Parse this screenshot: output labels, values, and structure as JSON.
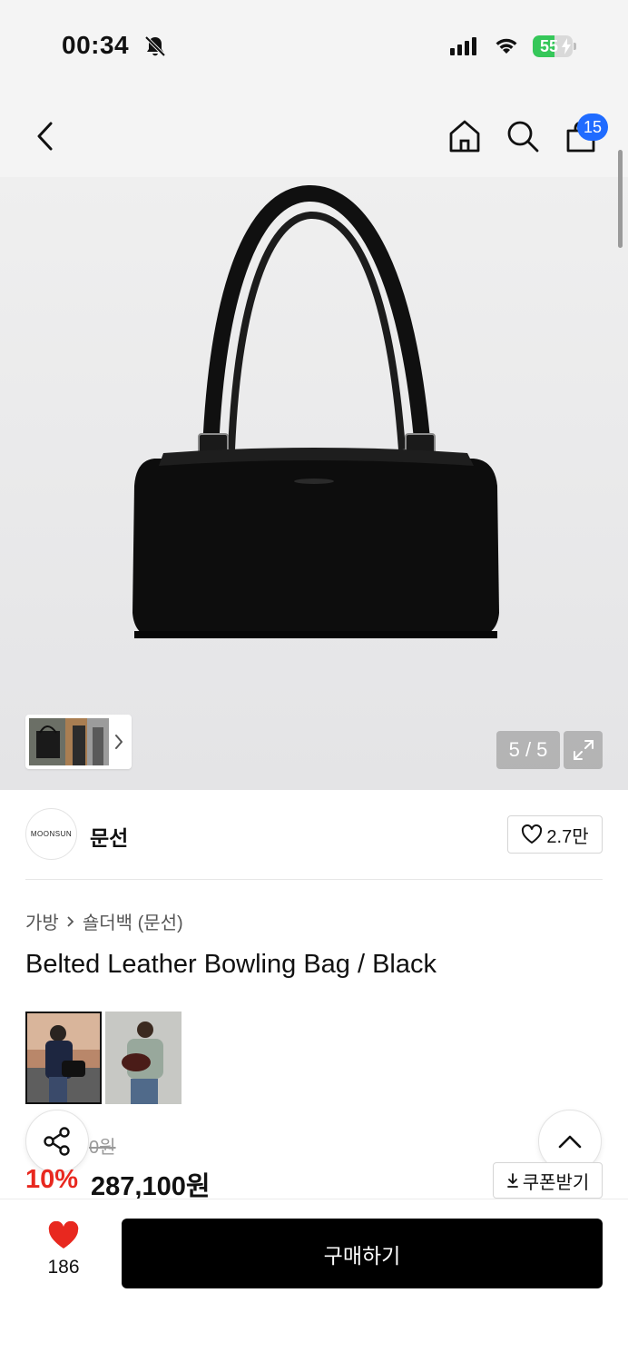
{
  "status_bar": {
    "time": "00:34",
    "battery": "55",
    "battery_level": 0.55
  },
  "nav": {
    "cart_badge": "15"
  },
  "gallery": {
    "counter": "5 / 5"
  },
  "brand": {
    "logo_text": "MOONSUN",
    "name": "문선",
    "like_count": "2.7만"
  },
  "breadcrumb": {
    "category": "가방",
    "subcategory": "숄더백 (문선)"
  },
  "product": {
    "title": "Belted Leather Bowling Bag / Black",
    "original_price": "0원",
    "discount": "10%",
    "price": "287,100원"
  },
  "coupon": {
    "label": "쿠폰받기"
  },
  "bottom": {
    "wish_count": "186",
    "buy_label": "구매하기"
  },
  "icons": {
    "back": "chevron-left-icon",
    "home": "home-icon",
    "search": "search-icon",
    "cart": "shopping-bag-icon",
    "share": "share-icon",
    "up": "chevron-up-icon",
    "heart": "heart-icon",
    "download": "download-icon",
    "expand": "expand-icon"
  },
  "colors": {
    "accent": "#1f6bff",
    "discount": "#e8281f",
    "heart": "#e8281f",
    "buy_button": "#000000"
  }
}
